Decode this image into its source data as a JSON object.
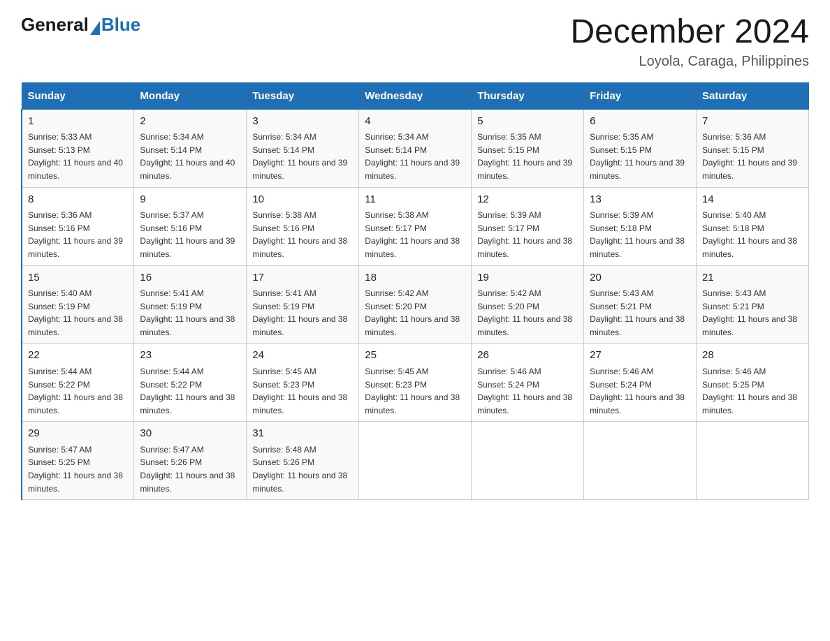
{
  "logo": {
    "general": "General",
    "blue": "Blue"
  },
  "title": "December 2024",
  "subtitle": "Loyola, Caraga, Philippines",
  "weekdays": [
    "Sunday",
    "Monday",
    "Tuesday",
    "Wednesday",
    "Thursday",
    "Friday",
    "Saturday"
  ],
  "weeks": [
    [
      {
        "day": 1,
        "sunrise": "5:33 AM",
        "sunset": "5:13 PM",
        "daylight": "11 hours and 40 minutes."
      },
      {
        "day": 2,
        "sunrise": "5:34 AM",
        "sunset": "5:14 PM",
        "daylight": "11 hours and 40 minutes."
      },
      {
        "day": 3,
        "sunrise": "5:34 AM",
        "sunset": "5:14 PM",
        "daylight": "11 hours and 39 minutes."
      },
      {
        "day": 4,
        "sunrise": "5:34 AM",
        "sunset": "5:14 PM",
        "daylight": "11 hours and 39 minutes."
      },
      {
        "day": 5,
        "sunrise": "5:35 AM",
        "sunset": "5:15 PM",
        "daylight": "11 hours and 39 minutes."
      },
      {
        "day": 6,
        "sunrise": "5:35 AM",
        "sunset": "5:15 PM",
        "daylight": "11 hours and 39 minutes."
      },
      {
        "day": 7,
        "sunrise": "5:36 AM",
        "sunset": "5:15 PM",
        "daylight": "11 hours and 39 minutes."
      }
    ],
    [
      {
        "day": 8,
        "sunrise": "5:36 AM",
        "sunset": "5:16 PM",
        "daylight": "11 hours and 39 minutes."
      },
      {
        "day": 9,
        "sunrise": "5:37 AM",
        "sunset": "5:16 PM",
        "daylight": "11 hours and 39 minutes."
      },
      {
        "day": 10,
        "sunrise": "5:38 AM",
        "sunset": "5:16 PM",
        "daylight": "11 hours and 38 minutes."
      },
      {
        "day": 11,
        "sunrise": "5:38 AM",
        "sunset": "5:17 PM",
        "daylight": "11 hours and 38 minutes."
      },
      {
        "day": 12,
        "sunrise": "5:39 AM",
        "sunset": "5:17 PM",
        "daylight": "11 hours and 38 minutes."
      },
      {
        "day": 13,
        "sunrise": "5:39 AM",
        "sunset": "5:18 PM",
        "daylight": "11 hours and 38 minutes."
      },
      {
        "day": 14,
        "sunrise": "5:40 AM",
        "sunset": "5:18 PM",
        "daylight": "11 hours and 38 minutes."
      }
    ],
    [
      {
        "day": 15,
        "sunrise": "5:40 AM",
        "sunset": "5:19 PM",
        "daylight": "11 hours and 38 minutes."
      },
      {
        "day": 16,
        "sunrise": "5:41 AM",
        "sunset": "5:19 PM",
        "daylight": "11 hours and 38 minutes."
      },
      {
        "day": 17,
        "sunrise": "5:41 AM",
        "sunset": "5:19 PM",
        "daylight": "11 hours and 38 minutes."
      },
      {
        "day": 18,
        "sunrise": "5:42 AM",
        "sunset": "5:20 PM",
        "daylight": "11 hours and 38 minutes."
      },
      {
        "day": 19,
        "sunrise": "5:42 AM",
        "sunset": "5:20 PM",
        "daylight": "11 hours and 38 minutes."
      },
      {
        "day": 20,
        "sunrise": "5:43 AM",
        "sunset": "5:21 PM",
        "daylight": "11 hours and 38 minutes."
      },
      {
        "day": 21,
        "sunrise": "5:43 AM",
        "sunset": "5:21 PM",
        "daylight": "11 hours and 38 minutes."
      }
    ],
    [
      {
        "day": 22,
        "sunrise": "5:44 AM",
        "sunset": "5:22 PM",
        "daylight": "11 hours and 38 minutes."
      },
      {
        "day": 23,
        "sunrise": "5:44 AM",
        "sunset": "5:22 PM",
        "daylight": "11 hours and 38 minutes."
      },
      {
        "day": 24,
        "sunrise": "5:45 AM",
        "sunset": "5:23 PM",
        "daylight": "11 hours and 38 minutes."
      },
      {
        "day": 25,
        "sunrise": "5:45 AM",
        "sunset": "5:23 PM",
        "daylight": "11 hours and 38 minutes."
      },
      {
        "day": 26,
        "sunrise": "5:46 AM",
        "sunset": "5:24 PM",
        "daylight": "11 hours and 38 minutes."
      },
      {
        "day": 27,
        "sunrise": "5:46 AM",
        "sunset": "5:24 PM",
        "daylight": "11 hours and 38 minutes."
      },
      {
        "day": 28,
        "sunrise": "5:46 AM",
        "sunset": "5:25 PM",
        "daylight": "11 hours and 38 minutes."
      }
    ],
    [
      {
        "day": 29,
        "sunrise": "5:47 AM",
        "sunset": "5:25 PM",
        "daylight": "11 hours and 38 minutes."
      },
      {
        "day": 30,
        "sunrise": "5:47 AM",
        "sunset": "5:26 PM",
        "daylight": "11 hours and 38 minutes."
      },
      {
        "day": 31,
        "sunrise": "5:48 AM",
        "sunset": "5:26 PM",
        "daylight": "11 hours and 38 minutes."
      },
      null,
      null,
      null,
      null
    ]
  ]
}
